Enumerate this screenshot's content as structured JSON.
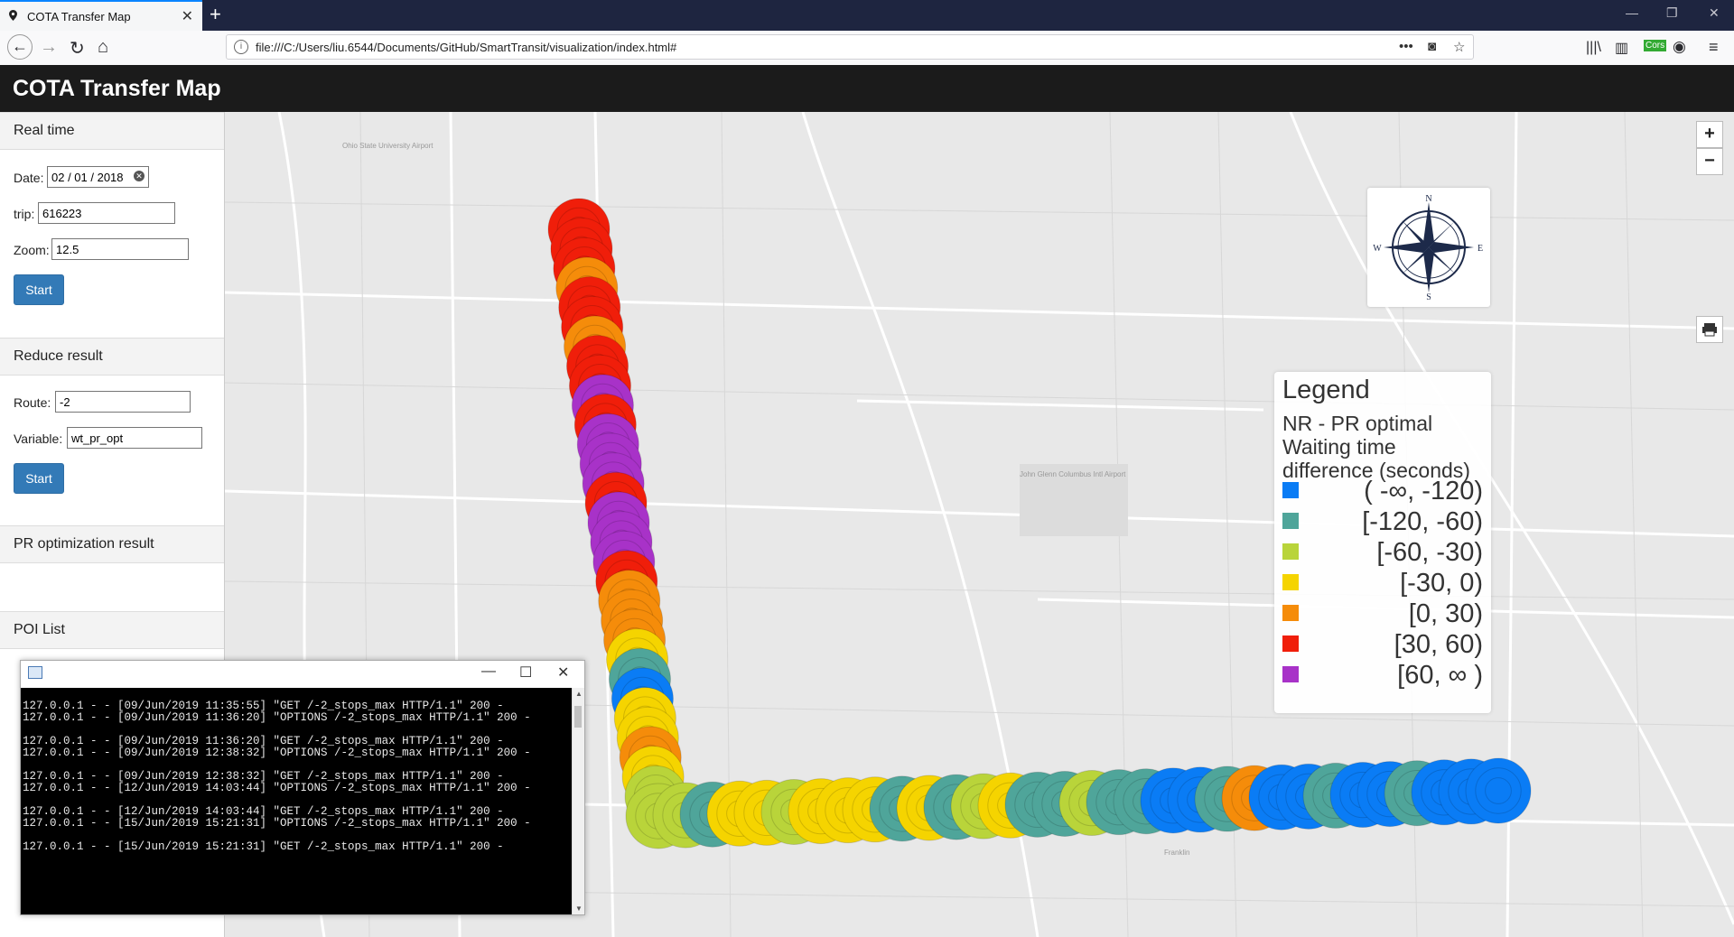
{
  "browser": {
    "tab_title": "COTA Transfer Map",
    "url": "file:///C:/Users/liu.6544/Documents/GitHub/SmartTransit/visualization/index.html#"
  },
  "app": {
    "title": "COTA Transfer Map"
  },
  "sidebar": {
    "realtime": {
      "heading": "Real time",
      "date_label": "Date:",
      "date_value": "02 / 01 / 2018",
      "trip_label": "trip:",
      "trip_value": "616223",
      "zoom_label": "Zoom:",
      "zoom_value": "12.5",
      "start_label": "Start"
    },
    "reduce": {
      "heading": "Reduce result",
      "route_label": "Route:",
      "route_value": "-2",
      "variable_label": "Variable:",
      "variable_value": "wt_pr_opt",
      "start_label": "Start"
    },
    "pr_heading": "PR optimization result",
    "poi_heading": "POI List"
  },
  "map": {
    "zoom_in": "+",
    "zoom_out": "−",
    "compass": {
      "n": "N",
      "s": "S",
      "e": "E",
      "w": "W"
    },
    "place_labels": [
      {
        "text": "Ohio State University Airport"
      },
      {
        "text": "John Glenn Columbus Intl Airport"
      },
      {
        "text": "Franklin"
      }
    ]
  },
  "legend": {
    "title": "Legend",
    "subtitle": "NR - PR optimal Waiting time difference (seconds)",
    "items": [
      {
        "label": "( -∞, -120)",
        "color": "#0a7cf5"
      },
      {
        "label": "[-120, -60)",
        "color": "#4fa59a"
      },
      {
        "label": "[-60, -30)",
        "color": "#b9d43a"
      },
      {
        "label": "[-30, 0)",
        "color": "#f5d400"
      },
      {
        "label": "[0, 30)",
        "color": "#f58c0a"
      },
      {
        "label": "[30, 60)",
        "color": "#f01e0a"
      },
      {
        "label": "[60, ∞ )",
        "color": "#a832c8"
      }
    ]
  },
  "console": {
    "lines": [
      "",
      "127.0.0.1 - - [09/Jun/2019 11:35:55] \"GET /-2_stops_max HTTP/1.1\" 200 -",
      "127.0.0.1 - - [09/Jun/2019 11:36:20] \"OPTIONS /-2_stops_max HTTP/1.1\" 200 -",
      "",
      "127.0.0.1 - - [09/Jun/2019 11:36:20] \"GET /-2_stops_max HTTP/1.1\" 200 -",
      "127.0.0.1 - - [09/Jun/2019 12:38:32] \"OPTIONS /-2_stops_max HTTP/1.1\" 200 -",
      "",
      "127.0.0.1 - - [09/Jun/2019 12:38:32] \"GET /-2_stops_max HTTP/1.1\" 200 -",
      "127.0.0.1 - - [12/Jun/2019 14:03:44] \"OPTIONS /-2_stops_max HTTP/1.1\" 200 -",
      "",
      "127.0.0.1 - - [12/Jun/2019 14:03:44] \"GET /-2_stops_max HTTP/1.1\" 200 -",
      "127.0.0.1 - - [15/Jun/2019 15:21:31] \"OPTIONS /-2_stops_max HTTP/1.1\" 200 -",
      "",
      "127.0.0.1 - - [15/Jun/2019 15:21:31] \"GET /-2_stops_max HTTP/1.1\" 200 -"
    ]
  },
  "route": {
    "vertical_colors": [
      "#f01e0a",
      "#f01e0a",
      "#f01e0a",
      "#f58c0a",
      "#f01e0a",
      "#f01e0a",
      "#f58c0a",
      "#f01e0a",
      "#f01e0a",
      "#a832c8",
      "#f01e0a",
      "#a832c8",
      "#a832c8",
      "#a832c8",
      "#f01e0a",
      "#a832c8",
      "#a832c8",
      "#a832c8",
      "#f01e0a",
      "#f58c0a",
      "#f58c0a",
      "#f58c0a",
      "#f5d400",
      "#4fa59a",
      "#0a7cf5",
      "#f5d400",
      "#f5d400",
      "#f58c0a",
      "#f5d400",
      "#b9d43a",
      "#b9d43a"
    ],
    "horizontal_colors": [
      "#b9d43a",
      "#b9d43a",
      "#4fa59a",
      "#f5d400",
      "#f5d400",
      "#b9d43a",
      "#f5d400",
      "#f5d400",
      "#f5d400",
      "#4fa59a",
      "#f5d400",
      "#4fa59a",
      "#b9d43a",
      "#f5d400",
      "#4fa59a",
      "#4fa59a",
      "#b9d43a",
      "#4fa59a",
      "#4fa59a",
      "#0a7cf5",
      "#0a7cf5",
      "#4fa59a",
      "#f58c0a",
      "#0a7cf5",
      "#0a7cf5",
      "#4fa59a",
      "#0a7cf5",
      "#0a7cf5",
      "#4fa59a",
      "#0a7cf5",
      "#0a7cf5",
      "#0a7cf5"
    ]
  }
}
